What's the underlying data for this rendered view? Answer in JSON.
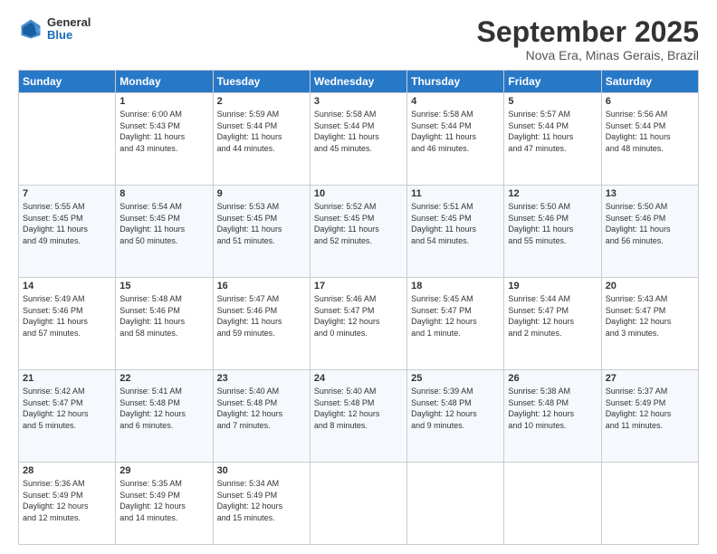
{
  "header": {
    "logo_general": "General",
    "logo_blue": "Blue",
    "month_title": "September 2025",
    "location": "Nova Era, Minas Gerais, Brazil"
  },
  "weekdays": [
    "Sunday",
    "Monday",
    "Tuesday",
    "Wednesday",
    "Thursday",
    "Friday",
    "Saturday"
  ],
  "weeks": [
    [
      {
        "day": "",
        "info": ""
      },
      {
        "day": "1",
        "info": "Sunrise: 6:00 AM\nSunset: 5:43 PM\nDaylight: 11 hours\nand 43 minutes."
      },
      {
        "day": "2",
        "info": "Sunrise: 5:59 AM\nSunset: 5:44 PM\nDaylight: 11 hours\nand 44 minutes."
      },
      {
        "day": "3",
        "info": "Sunrise: 5:58 AM\nSunset: 5:44 PM\nDaylight: 11 hours\nand 45 minutes."
      },
      {
        "day": "4",
        "info": "Sunrise: 5:58 AM\nSunset: 5:44 PM\nDaylight: 11 hours\nand 46 minutes."
      },
      {
        "day": "5",
        "info": "Sunrise: 5:57 AM\nSunset: 5:44 PM\nDaylight: 11 hours\nand 47 minutes."
      },
      {
        "day": "6",
        "info": "Sunrise: 5:56 AM\nSunset: 5:44 PM\nDaylight: 11 hours\nand 48 minutes."
      }
    ],
    [
      {
        "day": "7",
        "info": "Sunrise: 5:55 AM\nSunset: 5:45 PM\nDaylight: 11 hours\nand 49 minutes."
      },
      {
        "day": "8",
        "info": "Sunrise: 5:54 AM\nSunset: 5:45 PM\nDaylight: 11 hours\nand 50 minutes."
      },
      {
        "day": "9",
        "info": "Sunrise: 5:53 AM\nSunset: 5:45 PM\nDaylight: 11 hours\nand 51 minutes."
      },
      {
        "day": "10",
        "info": "Sunrise: 5:52 AM\nSunset: 5:45 PM\nDaylight: 11 hours\nand 52 minutes."
      },
      {
        "day": "11",
        "info": "Sunrise: 5:51 AM\nSunset: 5:45 PM\nDaylight: 11 hours\nand 54 minutes."
      },
      {
        "day": "12",
        "info": "Sunrise: 5:50 AM\nSunset: 5:46 PM\nDaylight: 11 hours\nand 55 minutes."
      },
      {
        "day": "13",
        "info": "Sunrise: 5:50 AM\nSunset: 5:46 PM\nDaylight: 11 hours\nand 56 minutes."
      }
    ],
    [
      {
        "day": "14",
        "info": "Sunrise: 5:49 AM\nSunset: 5:46 PM\nDaylight: 11 hours\nand 57 minutes."
      },
      {
        "day": "15",
        "info": "Sunrise: 5:48 AM\nSunset: 5:46 PM\nDaylight: 11 hours\nand 58 minutes."
      },
      {
        "day": "16",
        "info": "Sunrise: 5:47 AM\nSunset: 5:46 PM\nDaylight: 11 hours\nand 59 minutes."
      },
      {
        "day": "17",
        "info": "Sunrise: 5:46 AM\nSunset: 5:47 PM\nDaylight: 12 hours\nand 0 minutes."
      },
      {
        "day": "18",
        "info": "Sunrise: 5:45 AM\nSunset: 5:47 PM\nDaylight: 12 hours\nand 1 minute."
      },
      {
        "day": "19",
        "info": "Sunrise: 5:44 AM\nSunset: 5:47 PM\nDaylight: 12 hours\nand 2 minutes."
      },
      {
        "day": "20",
        "info": "Sunrise: 5:43 AM\nSunset: 5:47 PM\nDaylight: 12 hours\nand 3 minutes."
      }
    ],
    [
      {
        "day": "21",
        "info": "Sunrise: 5:42 AM\nSunset: 5:47 PM\nDaylight: 12 hours\nand 5 minutes."
      },
      {
        "day": "22",
        "info": "Sunrise: 5:41 AM\nSunset: 5:48 PM\nDaylight: 12 hours\nand 6 minutes."
      },
      {
        "day": "23",
        "info": "Sunrise: 5:40 AM\nSunset: 5:48 PM\nDaylight: 12 hours\nand 7 minutes."
      },
      {
        "day": "24",
        "info": "Sunrise: 5:40 AM\nSunset: 5:48 PM\nDaylight: 12 hours\nand 8 minutes."
      },
      {
        "day": "25",
        "info": "Sunrise: 5:39 AM\nSunset: 5:48 PM\nDaylight: 12 hours\nand 9 minutes."
      },
      {
        "day": "26",
        "info": "Sunrise: 5:38 AM\nSunset: 5:48 PM\nDaylight: 12 hours\nand 10 minutes."
      },
      {
        "day": "27",
        "info": "Sunrise: 5:37 AM\nSunset: 5:49 PM\nDaylight: 12 hours\nand 11 minutes."
      }
    ],
    [
      {
        "day": "28",
        "info": "Sunrise: 5:36 AM\nSunset: 5:49 PM\nDaylight: 12 hours\nand 12 minutes."
      },
      {
        "day": "29",
        "info": "Sunrise: 5:35 AM\nSunset: 5:49 PM\nDaylight: 12 hours\nand 14 minutes."
      },
      {
        "day": "30",
        "info": "Sunrise: 5:34 AM\nSunset: 5:49 PM\nDaylight: 12 hours\nand 15 minutes."
      },
      {
        "day": "",
        "info": ""
      },
      {
        "day": "",
        "info": ""
      },
      {
        "day": "",
        "info": ""
      },
      {
        "day": "",
        "info": ""
      }
    ]
  ]
}
